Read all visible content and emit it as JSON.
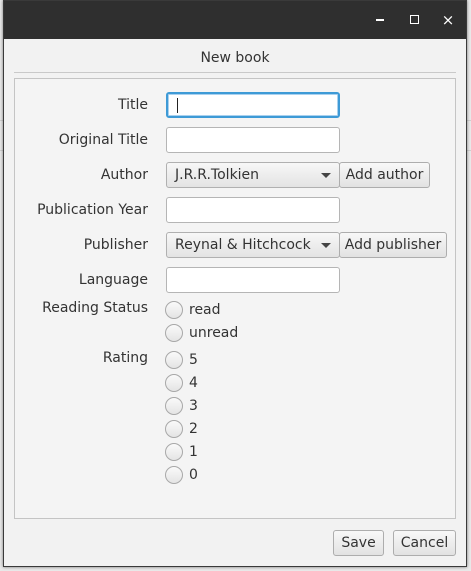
{
  "window": {
    "controls": {
      "minimize": "minimize-icon",
      "maximize": "maximize-icon",
      "close": "close-icon",
      "close_glyph": "×"
    }
  },
  "dialog": {
    "title": "New book"
  },
  "form": {
    "title_label": "Title",
    "title_value": "",
    "original_title_label": "Original Title",
    "original_title_value": "",
    "author_label": "Author",
    "author_selected": "J.R.R.Tolkien",
    "add_author_label": "Add author",
    "publication_year_label": "Publication Year",
    "publication_year_value": "",
    "publisher_label": "Publisher",
    "publisher_selected": "Reynal & Hitchcock",
    "add_publisher_label": "Add publisher",
    "language_label": "Language",
    "language_value": "",
    "reading_status_label": "Reading Status",
    "reading_status_options": [
      "read",
      "unread"
    ],
    "rating_label": "Rating",
    "rating_options": [
      "5",
      "4",
      "3",
      "2",
      "1",
      "0"
    ]
  },
  "footer": {
    "save_label": "Save",
    "cancel_label": "Cancel"
  },
  "colors": {
    "titlebar": "#2f2f2f",
    "focus_ring": "#3e9ad6",
    "dialog_bg": "#f2f2f2"
  }
}
